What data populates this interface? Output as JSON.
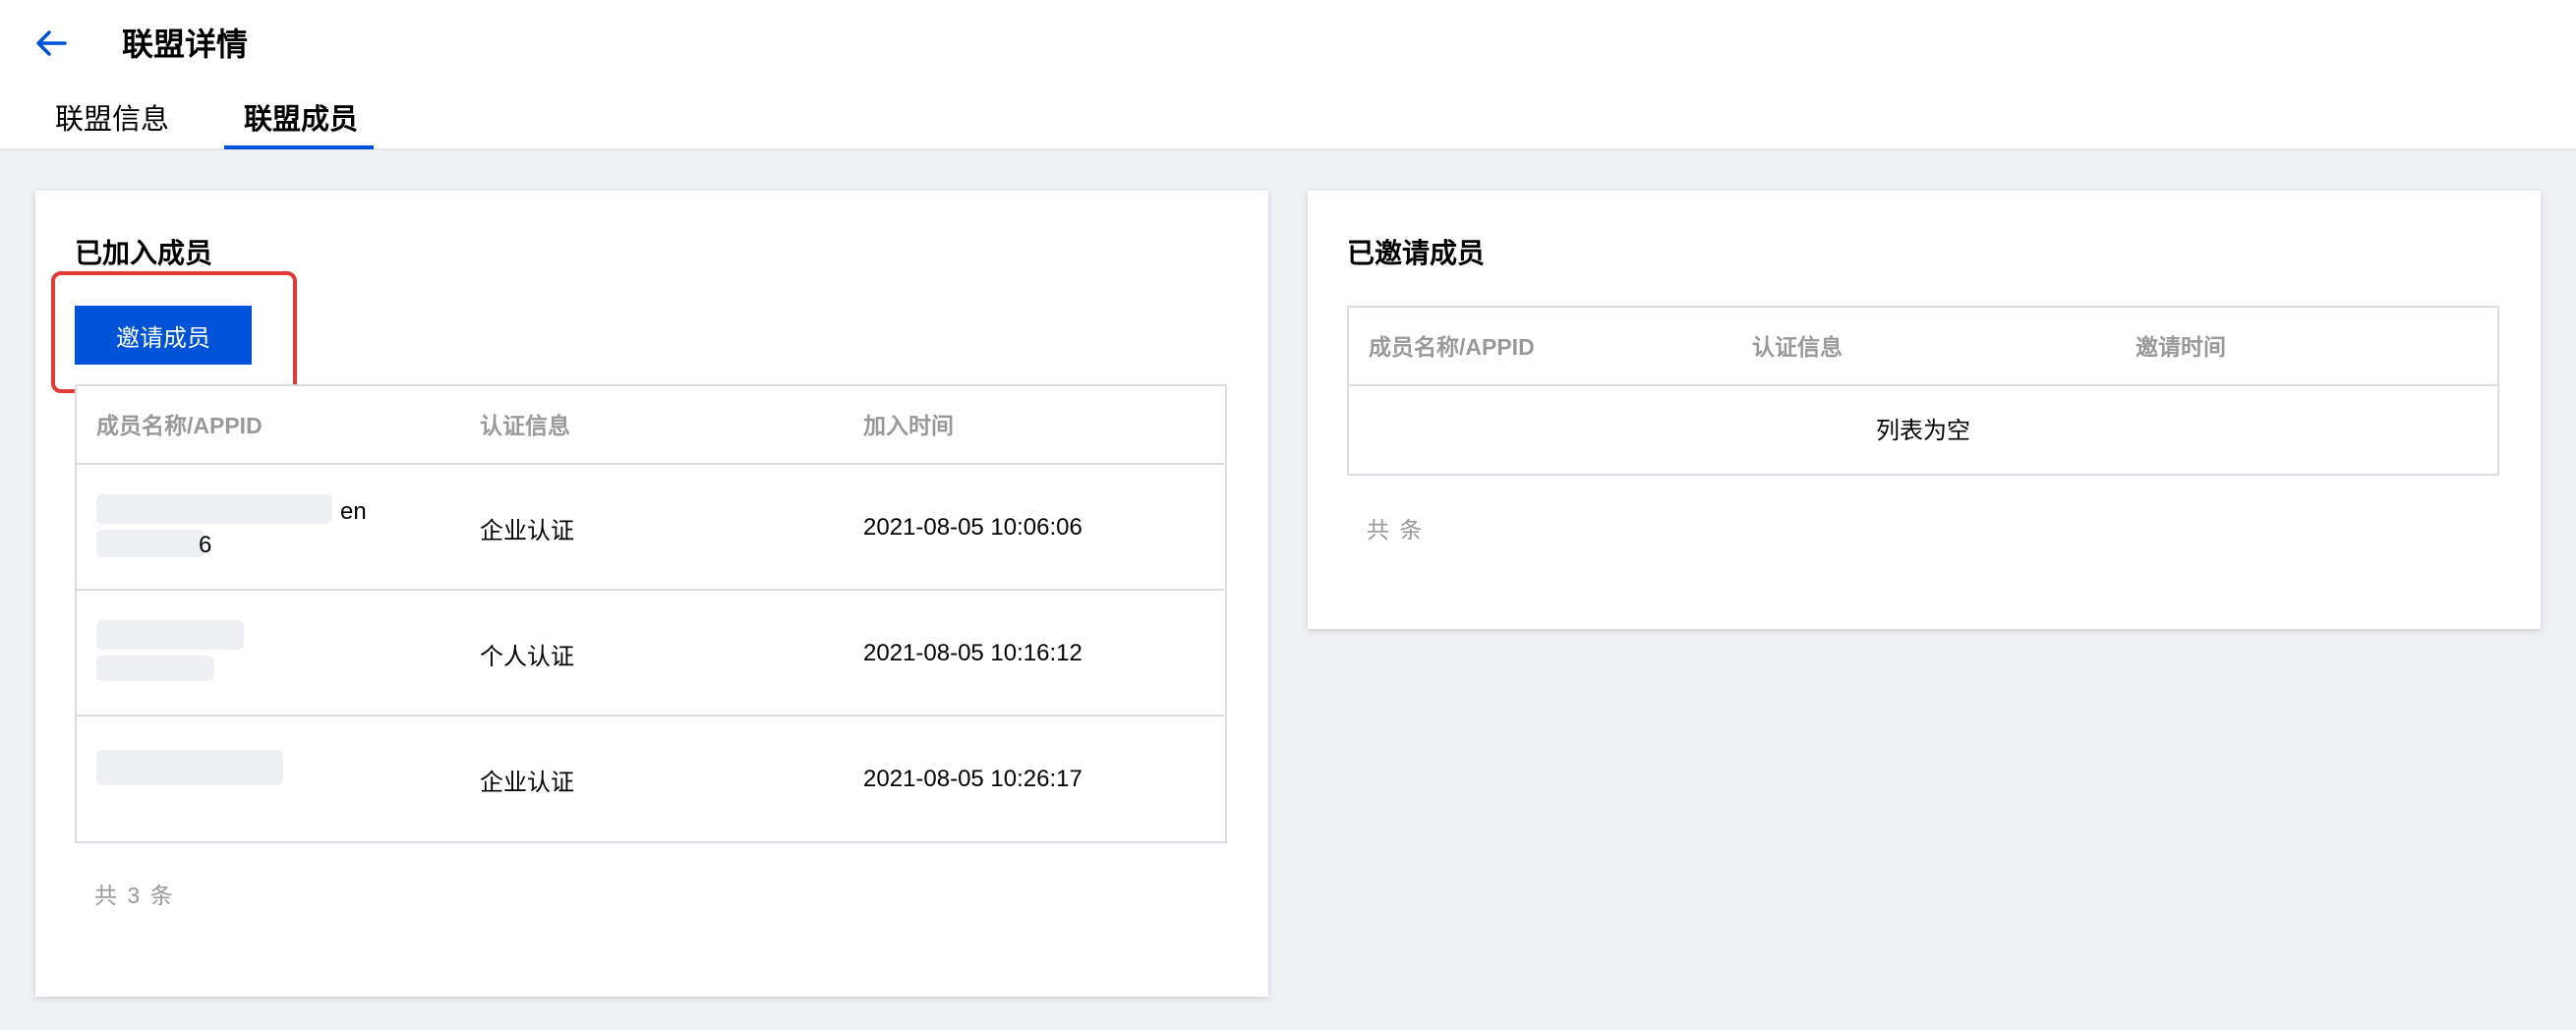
{
  "header": {
    "title": "联盟详情",
    "tabs": [
      {
        "label": "联盟信息",
        "active": false
      },
      {
        "label": "联盟成员",
        "active": true
      }
    ]
  },
  "colors": {
    "primary": "#0052d9",
    "highlight": "#e53935",
    "muted_text": "#999999",
    "page_background": "#f0f1f4"
  },
  "joined": {
    "title": "已加入成员",
    "invite_button": "邀请成员",
    "columns": [
      "成员名称/APPID",
      "认证信息",
      "加入时间"
    ],
    "rows": [
      {
        "name_visible_fragment_1": "en",
        "name_visible_fragment_2": "6",
        "cert": "企业认证",
        "time": "2021-08-05 10:06:06"
      },
      {
        "name_visible_fragment_1": "",
        "name_visible_fragment_2": "",
        "cert": "个人认证",
        "time": "2021-08-05 10:16:12"
      },
      {
        "name_visible_fragment_1": "",
        "name_visible_fragment_2": "",
        "cert": "企业认证",
        "time": "2021-08-05 10:26:17"
      }
    ],
    "total": "共 3 条"
  },
  "invited": {
    "title": "已邀请成员",
    "columns": [
      "成员名称/APPID",
      "认证信息",
      "邀请时间"
    ],
    "empty_text": "列表为空",
    "total": "共 条"
  },
  "icons": {
    "back": "arrow-left-icon"
  }
}
